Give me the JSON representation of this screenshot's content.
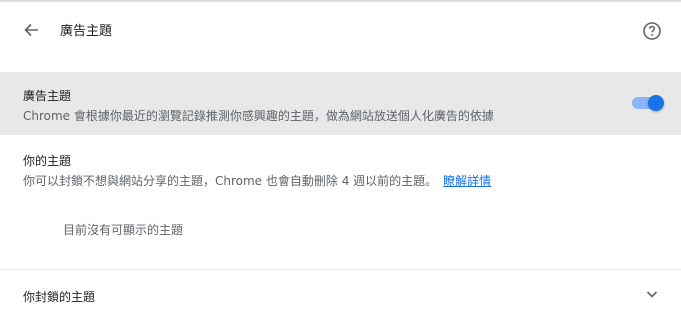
{
  "header": {
    "title": "廣告主題",
    "back_icon": "arrow-back-icon",
    "help_icon": "help-circle-icon"
  },
  "ad_topics_toggle": {
    "title": "廣告主題",
    "description": "Chrome 會根據你最近的瀏覽記錄推測你感興趣的主題，做為網站放送個人化廣告的依據",
    "enabled": true,
    "accent_color": "#1a73e8"
  },
  "your_topics": {
    "title": "你的主題",
    "description": "你可以封鎖不想與網站分享的主題，Chrome 也會自動刪除 4 週以前的主題。",
    "learn_more": "瞭解詳情",
    "empty_message": "目前沒有可顯示的主題"
  },
  "blocked_topics": {
    "label": "你封鎖的主題",
    "expand_icon": "chevron-down-icon"
  }
}
